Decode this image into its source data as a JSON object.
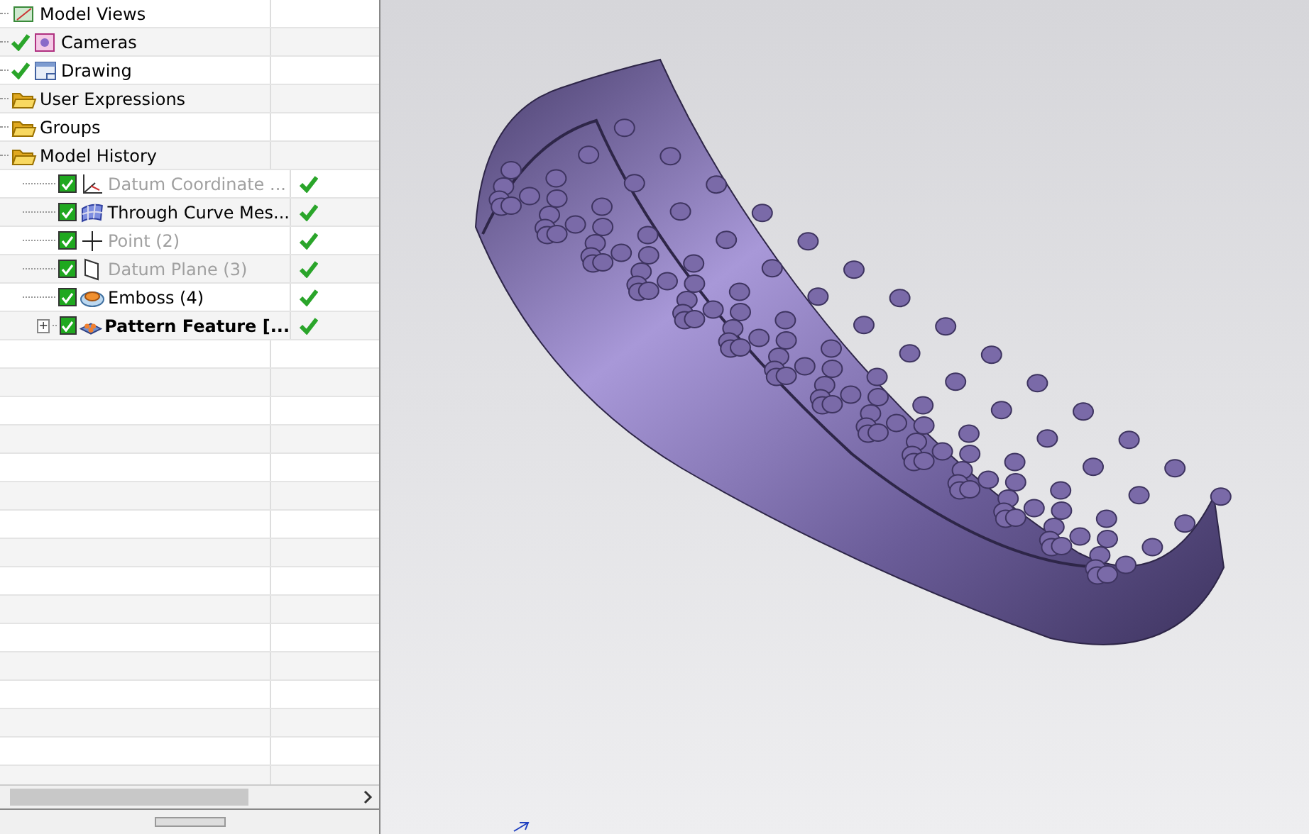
{
  "part_navigator": {
    "items": [
      {
        "label": "Model Views",
        "kind": "views"
      },
      {
        "label": "Cameras",
        "kind": "camera",
        "checked": true
      },
      {
        "label": "Drawing",
        "kind": "drawing",
        "checked": true
      },
      {
        "label": "User Expressions",
        "kind": "folder"
      },
      {
        "label": "Groups",
        "kind": "folder"
      },
      {
        "label": "Model History",
        "kind": "folder",
        "children": [
          {
            "label": "Datum Coordinate ...",
            "kind": "csys",
            "checked": true,
            "disabled": true,
            "active": false,
            "up_to_date": true
          },
          {
            "label": "Through Curve Mes...",
            "kind": "mesh",
            "checked": true,
            "disabled": false,
            "active": false,
            "up_to_date": true
          },
          {
            "label": "Point (2)",
            "kind": "point",
            "checked": true,
            "disabled": true,
            "active": false,
            "up_to_date": true
          },
          {
            "label": "Datum Plane (3)",
            "kind": "plane",
            "checked": true,
            "disabled": true,
            "active": false,
            "up_to_date": true
          },
          {
            "label": "Emboss (4)",
            "kind": "emboss",
            "checked": true,
            "disabled": false,
            "active": false,
            "up_to_date": true
          },
          {
            "label": "Pattern Feature [...",
            "kind": "pattern",
            "checked": true,
            "disabled": false,
            "active": true,
            "up_to_date": true,
            "expander": "+"
          }
        ]
      }
    ]
  }
}
